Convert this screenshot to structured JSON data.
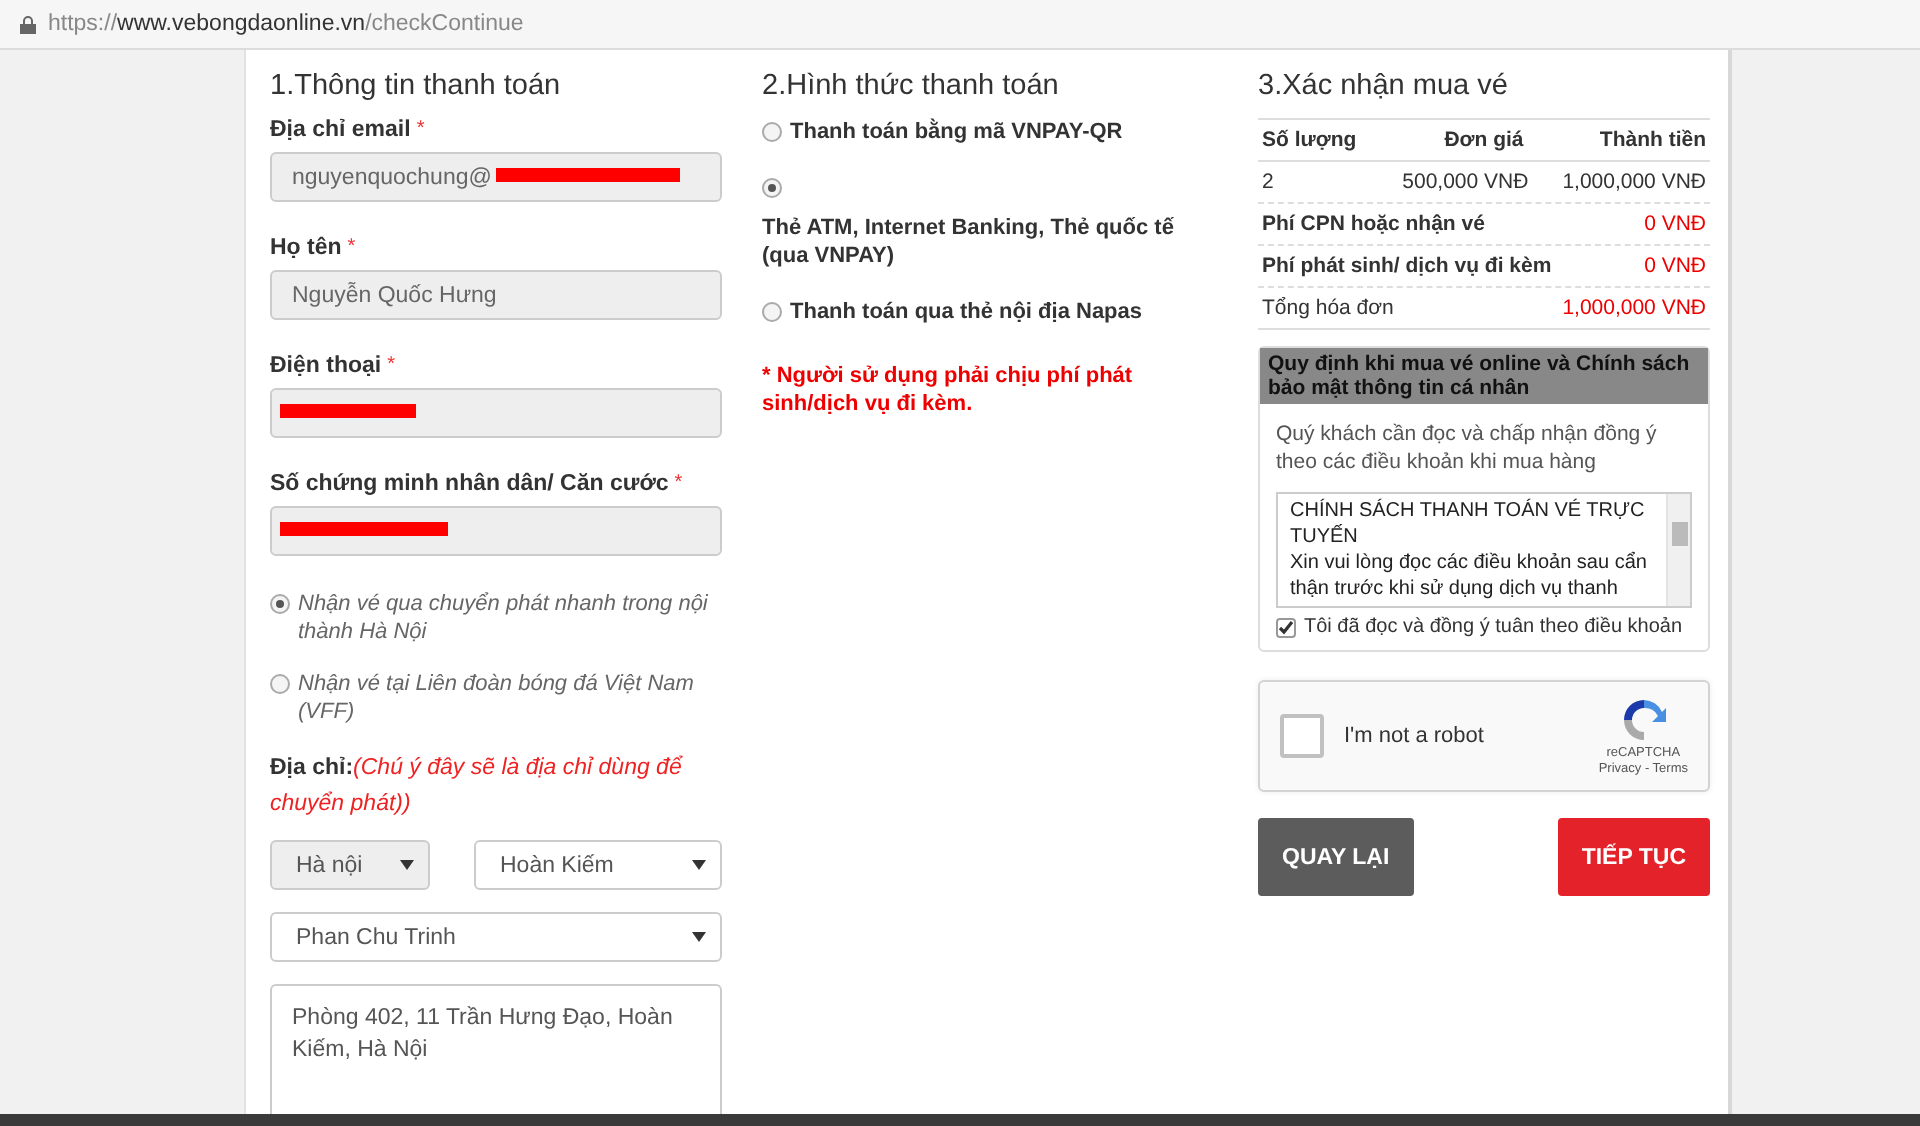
{
  "address_bar": {
    "scheme": "https://",
    "host": "www.vebongdaonline.vn",
    "path": "/checkContinue"
  },
  "billing": {
    "title": "1.Thông tin thanh toán",
    "fields": [
      {
        "label": "Địa chỉ email",
        "required_mark": "*",
        "value": "nguyenquochung@",
        "redacted": true
      },
      {
        "label": "Họ tên",
        "required_mark": "*",
        "value": "Nguyễn Quốc Hưng"
      },
      {
        "label": "Điện thoại",
        "required_mark": "*",
        "redacted": true
      },
      {
        "label": "Số chứng minh nhân dân/ Căn cước",
        "required_mark": "*",
        "redacted": true
      }
    ],
    "delivery_options": [
      {
        "label": "Nhận vé qua chuyển phát nhanh trong nội thành Hà Nội",
        "selected": true
      },
      {
        "label": "Nhận vé tại Liên đoàn bóng đá Việt Nam (VFF)",
        "selected": false
      }
    ],
    "address": {
      "label": "Địa chỉ:",
      "note": "(Chú ý đây sẽ là địa chỉ dùng để chuyển phát))",
      "selects": [
        {
          "value": "Hà nội",
          "disabled": true
        },
        {
          "value": "Hoàn Kiếm",
          "disabled": false
        },
        {
          "value": "Phan Chu Trinh",
          "disabled": false
        }
      ],
      "detail": "Phòng 402, 11 Trần Hưng Đạo, Hoàn Kiếm, Hà Nội"
    }
  },
  "payment": {
    "title": "2.Hình thức thanh toán",
    "methods": [
      {
        "label": "Thanh toán bằng mã VNPAY-QR",
        "selected": false,
        "kind": "inline"
      },
      {
        "label": "Thẻ ATM, Internet Banking, Thẻ quốc tế (qua VNPAY)",
        "selected": true,
        "kind": "stacked"
      },
      {
        "label": "Thanh toán qua thẻ nội địa Napas",
        "selected": false,
        "kind": "inline"
      }
    ],
    "note": "* Người sử dụng phải chịu phí phát sinh/dịch vụ đi kèm."
  },
  "confirmation": {
    "title": "3.Xác nhận mua vé",
    "columns": [
      "Số lượng",
      "Đơn giá",
      "Thành tiền"
    ],
    "rows": [
      [
        "2",
        "500,000 VNĐ",
        "1,000,000 VNĐ"
      ]
    ],
    "fees": [
      {
        "label": "Phí CPN hoặc nhận vé",
        "value": "0 VNĐ"
      },
      {
        "label": "Phí phát sinh/ dịch vụ đi kèm",
        "value": "0 VNĐ"
      },
      {
        "label": "Tổng hóa đơn",
        "value": "1,000,000 VNĐ"
      }
    ],
    "policy": {
      "title": "Quy định khi mua vé online và Chính sách bảo mật thông tin cá nhân",
      "intro": "Quý khách cần đọc và chấp nhận đồng ý theo các điều khoản khi mua hàng",
      "terms_title": "CHÍNH SÁCH THANH TOÁN VÉ TRỰC TUYẾN",
      "terms_body": "Xin vui lòng đọc các điều khoản sau cẩn thận trước khi sử dụng dịch vụ thanh",
      "agree": {
        "label": "Tôi đã đọc và đồng ý tuân theo điều khoản",
        "checked": true
      }
    },
    "captcha": {
      "label": "I'm not a robot",
      "checked": false,
      "brand": "reCAPTCHA",
      "links": "Privacy - Terms"
    },
    "buttons": [
      {
        "label": "QUAY LẠI",
        "kind": "secondary"
      },
      {
        "label": "TIẾP TỤC",
        "kind": "primary"
      }
    ]
  }
}
